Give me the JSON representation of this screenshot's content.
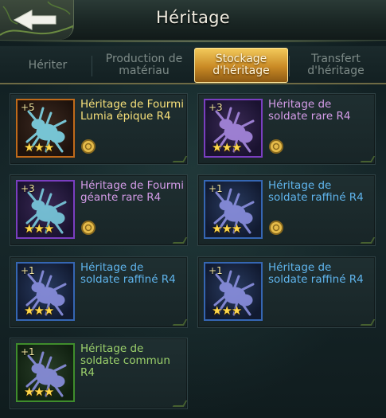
{
  "header": {
    "title": "Héritage",
    "back_icon": "back-arrow-icon"
  },
  "tabs": [
    {
      "label": "Hériter",
      "active": false
    },
    {
      "label": "Production de matériau",
      "active": false
    },
    {
      "label": "Stockage d'héritage",
      "active": true
    },
    {
      "label": "Transfert d'héritage",
      "active": false
    }
  ],
  "colors": {
    "accent_tab": "#d9a03a",
    "rarity_epic": "#c06a1a",
    "rarity_rare": "#7a3ec0",
    "rarity_refined": "#3566b3",
    "rarity_common": "#3f8d2c"
  },
  "items": [
    {
      "level": "+5",
      "name": "Héritage de Fourmi Lumia épique R4",
      "stars": "★★★",
      "rarity": "epic",
      "has_coin": true
    },
    {
      "level": "+3",
      "name": "Héritage de soldate rare R4",
      "stars": "★★★",
      "rarity": "rare",
      "has_coin": true
    },
    {
      "level": "+3",
      "name": "Héritage de Fourmi géante rare R4",
      "stars": "★★★",
      "rarity": "rare",
      "has_coin": true
    },
    {
      "level": "+1",
      "name": "Héritage de soldate raffiné R4",
      "stars": "★★★",
      "rarity": "refined",
      "has_coin": true
    },
    {
      "level": "+1",
      "name": "Héritage de soldate raffiné R4",
      "stars": "★★★",
      "rarity": "refined",
      "has_coin": false
    },
    {
      "level": "+1",
      "name": "Héritage de soldate raffiné R4",
      "stars": "★★★",
      "rarity": "refined",
      "has_coin": false
    },
    {
      "level": "+1",
      "name": "Héritage de soldate commun R4",
      "stars": "★★★",
      "rarity": "common",
      "has_coin": false
    }
  ]
}
